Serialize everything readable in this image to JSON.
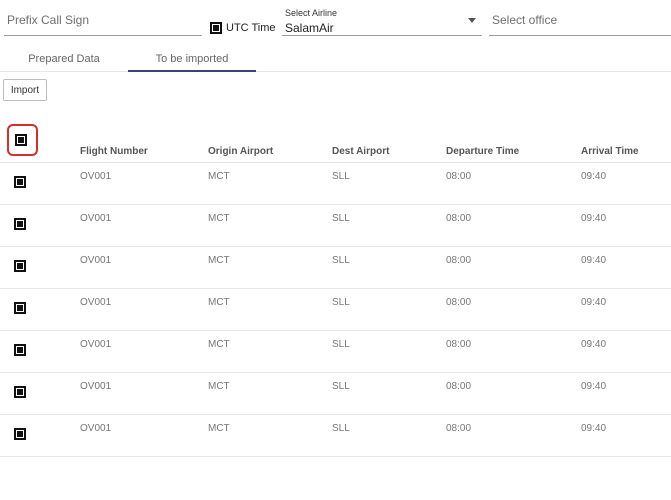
{
  "filters": {
    "prefix_placeholder": "Prefix Call Sign",
    "utc_label": "UTC Time",
    "airline_label": "Select Airline",
    "airline_value": "SalamAir",
    "office_placeholder": "Select office"
  },
  "tabs": [
    {
      "label": "Prepared Data",
      "active": false
    },
    {
      "label": "To be imported",
      "active": true
    }
  ],
  "colors": {
    "tab_indicator": "#3b3f7a",
    "highlight": "#d32f2f"
  },
  "toolbar": {
    "import_label": "Import"
  },
  "table": {
    "headers": [
      "Flight Number",
      "Origin Airport",
      "Dest Airport",
      "Departure Time",
      "Arrival Time"
    ],
    "rows": [
      [
        "OV001",
        "MCT",
        "SLL",
        "08:00",
        "09:40"
      ],
      [
        "OV001",
        "MCT",
        "SLL",
        "08:00",
        "09:40"
      ],
      [
        "OV001",
        "MCT",
        "SLL",
        "08:00",
        "09:40"
      ],
      [
        "OV001",
        "MCT",
        "SLL",
        "08:00",
        "09:40"
      ],
      [
        "OV001",
        "MCT",
        "SLL",
        "08:00",
        "09:40"
      ],
      [
        "OV001",
        "MCT",
        "SLL",
        "08:00",
        "09:40"
      ],
      [
        "OV001",
        "MCT",
        "SLL",
        "08:00",
        "09:40"
      ]
    ]
  }
}
